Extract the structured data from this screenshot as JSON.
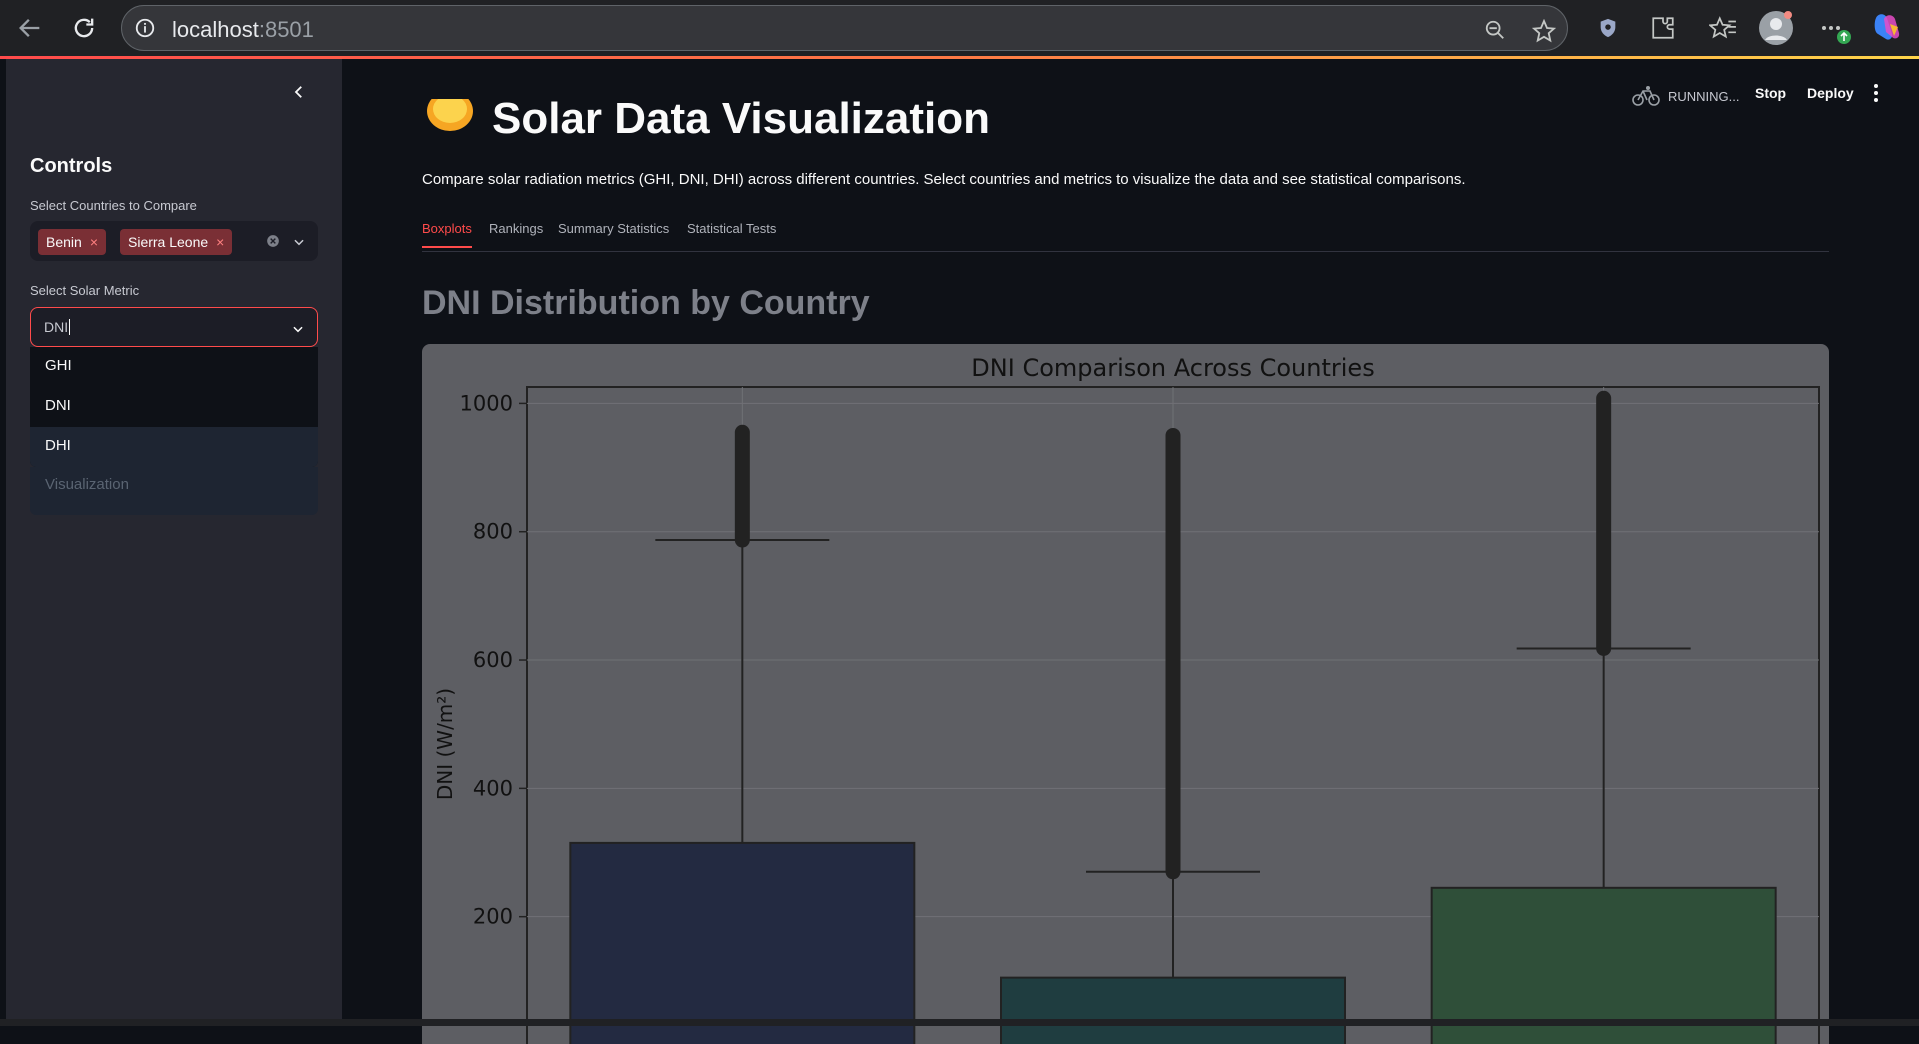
{
  "browser": {
    "url_host": "localhost",
    "url_port": ":8501"
  },
  "sidebar": {
    "title": "Controls",
    "countries_label": "Select Countries to Compare",
    "selected_countries": [
      "Benin",
      "Sierra Leone"
    ],
    "metric_label": "Select Solar Metric",
    "metric_value": "DNI",
    "metric_options": [
      "GHI",
      "DNI",
      "DHI"
    ],
    "hidden_section_label": "Visualization"
  },
  "header": {
    "status": "RUNNING...",
    "stop_label": "Stop",
    "deploy_label": "Deploy"
  },
  "main": {
    "title": "Solar Data Visualization",
    "subtitle": "Compare solar radiation metrics (GHI, DNI, DHI) across different countries. Select countries and metrics to visualize the data and see statistical comparisons.",
    "tabs": [
      "Boxplots",
      "Rankings",
      "Summary Statistics",
      "Statistical Tests"
    ],
    "active_tab": "Boxplots",
    "section_title": "DNI Distribution by Country"
  },
  "colors": {
    "accent": "#ff4b4b",
    "box_1": "#232a41",
    "box_2": "#1f3d40",
    "box_3": "#2f4f39"
  },
  "chart_data": {
    "type": "boxplot",
    "title": "DNI Comparison Across Countries",
    "ylabel": "DNI (W/m²)",
    "ylim_visible": [
      0,
      1050
    ],
    "yticks": [
      200,
      400,
      600,
      800,
      1000
    ],
    "grid": true,
    "series": [
      {
        "q3": 315,
        "upper_whisker": 787,
        "outlier_min": 787,
        "outlier_max": 955
      },
      {
        "q3": 105,
        "upper_whisker": 270,
        "outlier_min": 270,
        "outlier_max": 950
      },
      {
        "q3": 245,
        "upper_whisker": 618,
        "outlier_min": 618,
        "outlier_max": 1008
      }
    ]
  }
}
